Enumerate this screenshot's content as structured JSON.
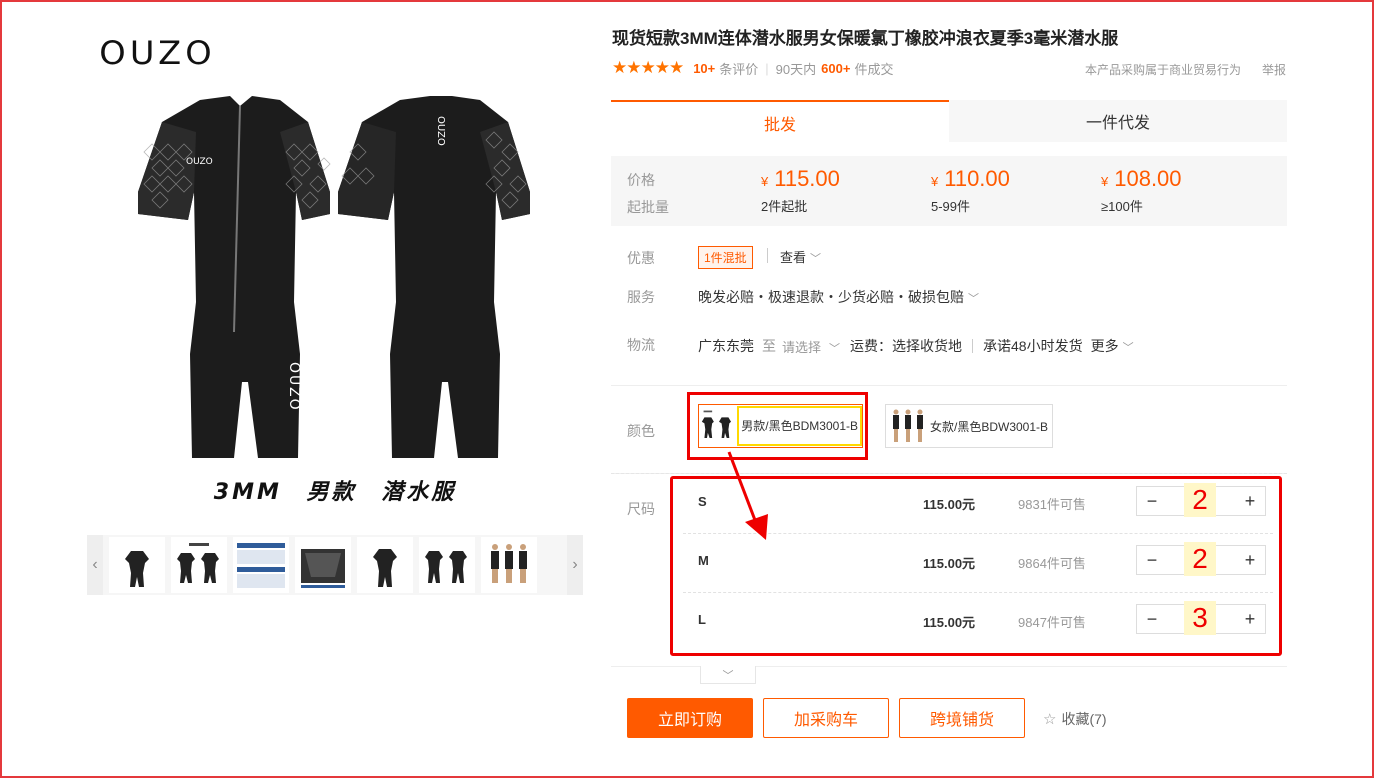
{
  "brand": "OUZO",
  "gallery": {
    "caption": "3MM 男款 潜水服",
    "photo_logo_front": "OUZO",
    "photo_logo_back": "OUZO",
    "prev_icon": "chevron-left-icon",
    "next_icon": "chevron-right-icon"
  },
  "product": {
    "title": "现货短款3MM连体潜水服男女保暖氯丁橡胶冲浪衣夏季3毫米潜水服",
    "stars": "★★★★★",
    "review_count": "10+",
    "review_label": "条评价",
    "period_label": "90天内",
    "sold_count": "600+",
    "sold_label": "件成交",
    "notice": "本产品采购属于商业贸易行为",
    "report": "举报"
  },
  "tabs": {
    "wholesale": "批发",
    "dropship": "一件代发"
  },
  "pricing": {
    "price_label": "价格",
    "moq_label": "起批量",
    "currency": "¥",
    "tiers": [
      {
        "price": "115.00",
        "qty": "2件起批"
      },
      {
        "price": "110.00",
        "qty": "5-99件"
      },
      {
        "price": "108.00",
        "qty": "≥100件"
      }
    ]
  },
  "discount": {
    "label": "优惠",
    "badge": "1件混批",
    "view": "查看"
  },
  "service": {
    "label": "服务",
    "text": "晚发必赔・极速退款・少货必赔・破损包赔"
  },
  "logistics": {
    "label": "物流",
    "origin": "广东东莞",
    "to": "至",
    "select": "请选择",
    "fee": "运费：选择收货地",
    "promise": "承诺48小时发货",
    "more": "更多"
  },
  "color": {
    "label": "颜色",
    "options": [
      {
        "label": "男款/黑色BDM3001-B",
        "selected": true
      },
      {
        "label": "女款/黑色BDW3001-B",
        "selected": false
      }
    ]
  },
  "size": {
    "label": "尺码",
    "rows": [
      {
        "name": "S",
        "price": "115.00元",
        "stock": "9831件可售",
        "qty": "2"
      },
      {
        "name": "M",
        "price": "115.00元",
        "stock": "9864件可售",
        "qty": "2"
      },
      {
        "name": "L",
        "price": "115.00元",
        "stock": "9847件可售",
        "qty": "3"
      }
    ],
    "minus": "−",
    "plus": "+"
  },
  "actions": {
    "buy": "立即订购",
    "cart": "加采购车",
    "cross": "跨境铺货",
    "favorite": "收藏(7)",
    "favorite_icon": "star-outline-icon",
    "expand_icon": "chevron-down-icon"
  },
  "colors": {
    "accent": "#ff5a00",
    "annotation": "#e00000",
    "highlight": "#ffd900"
  }
}
